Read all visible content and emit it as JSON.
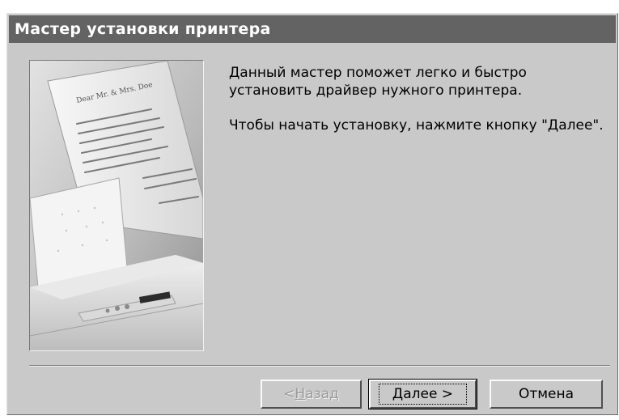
{
  "window": {
    "title": "Мастер установки принтера"
  },
  "content": {
    "intro_text": "Данный мастер поможет легко и быстро",
    "intro_text_line2": "установить драйвер нужного принтера.",
    "instruction_text": "Чтобы начать установку, нажмите кнопку \"Далее\"."
  },
  "buttons": {
    "back_prefix": "< ",
    "back_hotkey": "Н",
    "back_rest": "азад",
    "next_label": "Далее >",
    "cancel_label": "Отмена",
    "back_enabled": false,
    "next_focused": true
  },
  "illustration": {
    "icon": "printer-with-letter-image",
    "letter_greeting": "Dear Mr. & Mrs. Doe"
  },
  "colors": {
    "titlebar": "#636363",
    "dialog_face": "#c9c9c9",
    "disabled_text": "#9a9a9a"
  }
}
